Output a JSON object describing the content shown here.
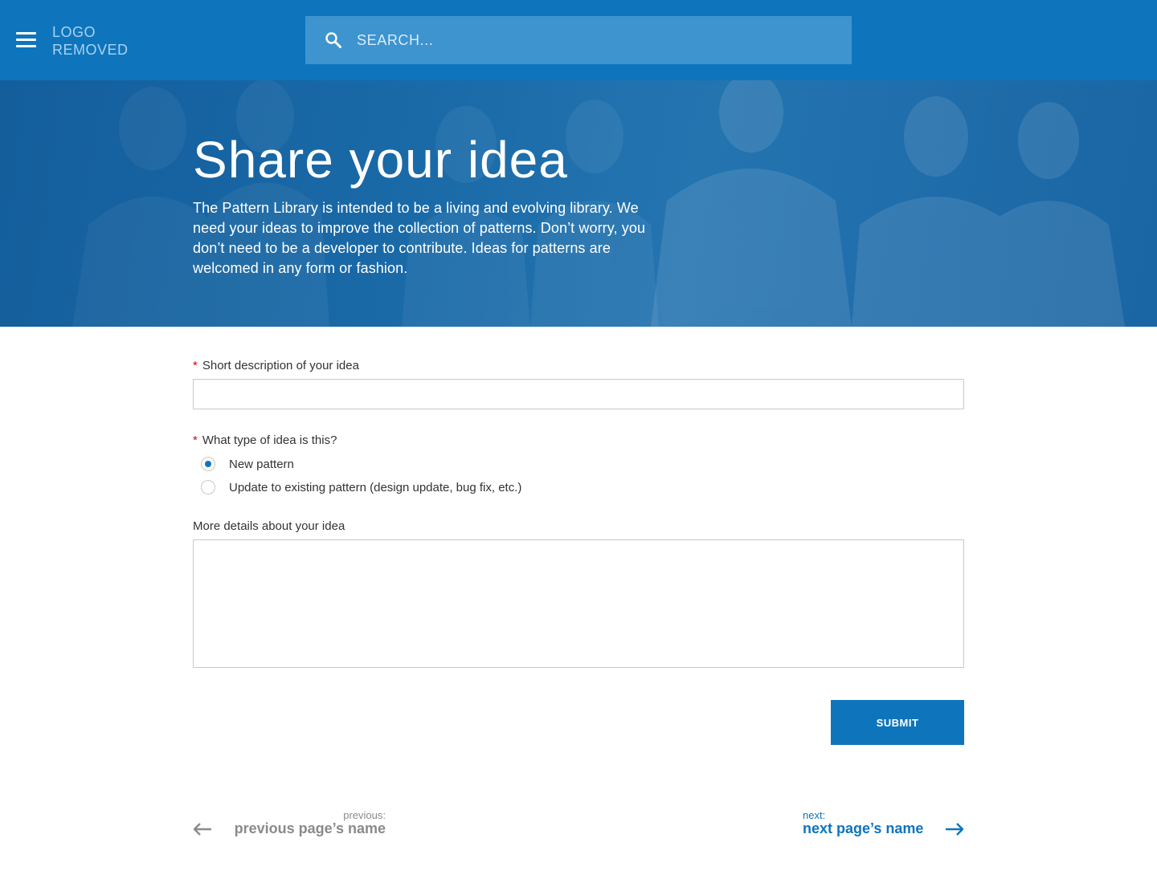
{
  "header": {
    "logo_line1": "LOGO",
    "logo_line2": "REMOVED",
    "search_placeholder": "SEARCH...",
    "menu_icon": "hamburger-menu-icon",
    "search_icon": "search-icon"
  },
  "hero": {
    "title": "Share your idea",
    "description": "The Pattern Library is intended to be a living and evolving library. We need your ideas to improve the collection of patterns. Don’t worry, you don’t need to be a developer to contribute. Ideas for patterns are welcomed in any form or fashion."
  },
  "form": {
    "required_marker": "*",
    "short_description_label": "Short description of your idea",
    "short_description_value": "",
    "idea_type_label": "What type of idea is this?",
    "idea_type_options": [
      {
        "label": "New pattern",
        "selected": true
      },
      {
        "label": "Update to existing pattern (design update, bug fix, etc.)",
        "selected": false
      }
    ],
    "details_label": "More details about your idea",
    "details_value": "",
    "submit_label": "SUBMIT"
  },
  "pager": {
    "previous_small": "previous:",
    "previous_name": "previous page’s name",
    "next_small": "next:",
    "next_name": "next page’s name"
  },
  "colors": {
    "primary": "#0e75bd",
    "search_bg": "#3e94cf",
    "required": "#d0021b",
    "muted": "#8a8a8a"
  }
}
